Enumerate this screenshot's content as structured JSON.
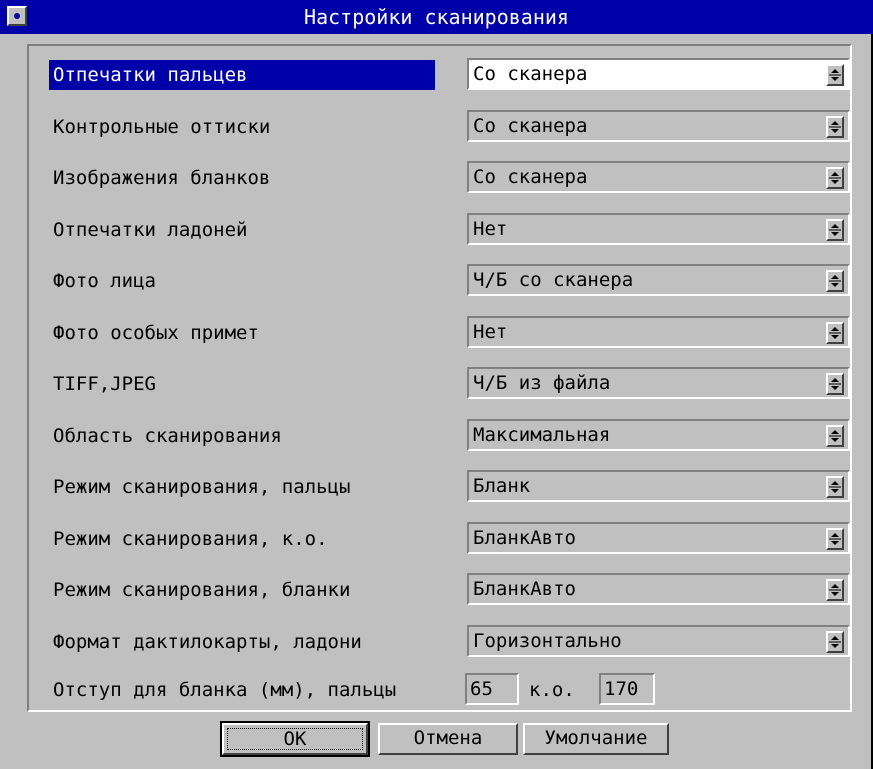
{
  "window": {
    "title": "Настройки сканирования"
  },
  "settings": [
    {
      "label": "Отпечатки пальцев",
      "value": "Со сканера"
    },
    {
      "label": "Контрольные оттиски",
      "value": "Со сканера"
    },
    {
      "label": "Изображения бланков",
      "value": "Со сканера"
    },
    {
      "label": "Отпечатки ладоней",
      "value": "Нет"
    },
    {
      "label": "Фото лица",
      "value": "Ч/Б со сканера"
    },
    {
      "label": "Фото особых примет",
      "value": "Нет"
    },
    {
      "label": "TIFF,JPEG",
      "value": "Ч/Б из файла"
    },
    {
      "label": "Область сканирования",
      "value": "Максимальная"
    },
    {
      "label": "Режим сканирования, пальцы",
      "value": "Бланк"
    },
    {
      "label": "Режим сканирования, к.о.",
      "value": "БланкАвто"
    },
    {
      "label": "Режим сканирования, бланки",
      "value": "БланкАвто"
    },
    {
      "label": "Формат дактилокарты, ладони",
      "value": "Горизонтально"
    }
  ],
  "offset": {
    "label": "Отступ для бланка (мм), пальцы",
    "fingers_value": "65",
    "ko_label": "к.о.",
    "ko_value": "170"
  },
  "buttons": {
    "ok": "OK",
    "cancel": "Отмена",
    "default": "Умолчание"
  },
  "colors": {
    "titlebar": "#0000a8",
    "face": "#c0c0c0",
    "highlight": "#0000a8"
  }
}
